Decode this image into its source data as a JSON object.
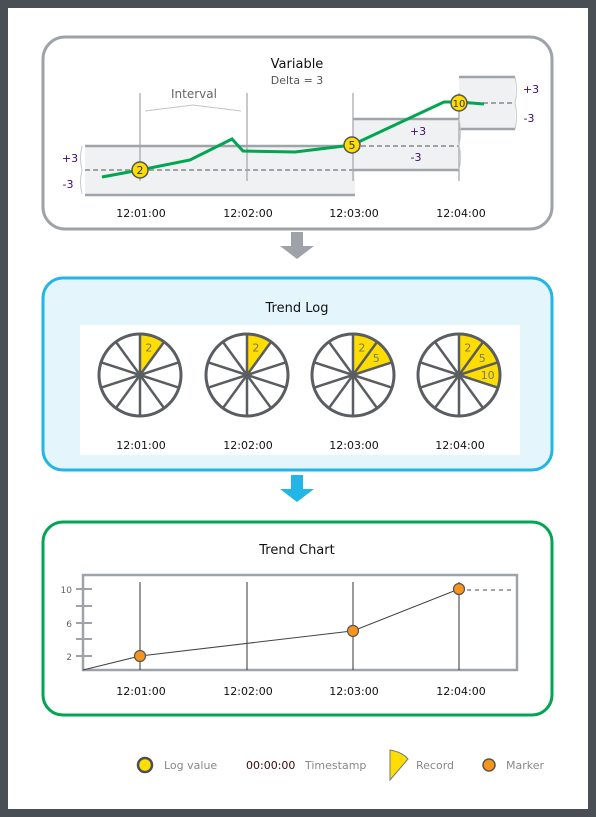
{
  "colors": {
    "frame": "#4a4f55",
    "variable_border": "#9ea3a9",
    "log_border": "#22b5e8",
    "log_fill": "#e4f6fc",
    "chart_border": "#00a651",
    "line": "#00a651",
    "yellow": "#ffdd00",
    "orange": "#f7941d",
    "label": "#3d0a6b"
  },
  "variable": {
    "title": "Variable",
    "subtitle": "Delta = 3",
    "interval_label": "Interval",
    "plus_label": "+3",
    "minus_label": "-3",
    "log_values": [
      "2",
      "5",
      "10"
    ],
    "timestamps": [
      "12:01:00",
      "12:02:00",
      "12:03:00",
      "12:04:00"
    ]
  },
  "trend_log": {
    "title": "Trend Log",
    "wheels": [
      {
        "records": [
          "2"
        ],
        "timestamp": "12:01:00"
      },
      {
        "records": [
          "2"
        ],
        "timestamp": "12:02:00"
      },
      {
        "records": [
          "2",
          "5"
        ],
        "timestamp": "12:03:00"
      },
      {
        "records": [
          "2",
          "5",
          "10"
        ],
        "timestamp": "12:04:00"
      }
    ]
  },
  "trend_chart": {
    "title": "Trend Chart",
    "y_ticks": [
      "2",
      "6",
      "10"
    ],
    "timestamps": [
      "12:01:00",
      "12:02:00",
      "12:03:00",
      "12:04:00"
    ],
    "markers": [
      2,
      5,
      10
    ]
  },
  "legend": {
    "log_value": "Log value",
    "timestamp_sample": "00:00:00",
    "timestamp": "Timestamp",
    "record": "Record",
    "marker": "Marker"
  }
}
